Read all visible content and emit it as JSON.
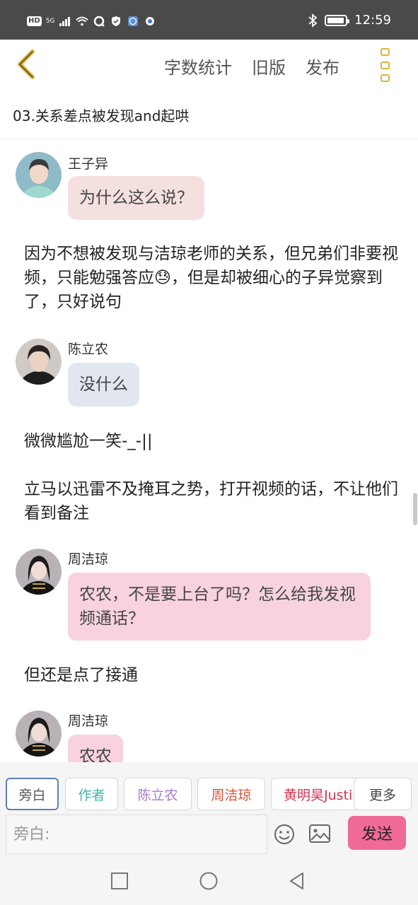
{
  "status_bar": {
    "left_badge": "HD",
    "signal": "5G",
    "time": "12:59"
  },
  "toolbar": {
    "back_icon": "chevron-left-icon",
    "word_count": "字数统计",
    "old_version": "旧版",
    "publish": "发布",
    "more_icon": "more-vertical-icon",
    "accent_color": "#d9b53a"
  },
  "chapter": {
    "title": "03.关系差点被发现and起哄"
  },
  "messages": [
    {
      "type": "chat",
      "name": "王子异",
      "text": "为什么这么说？",
      "bubble_color": "#f5e0e0"
    },
    {
      "type": "narration",
      "text": "因为不想被发现与洁琼老师的关系，但兄弟们非要视频，只能勉强答应😓，但是却被细心的子异觉察到了，只好说句"
    },
    {
      "type": "chat",
      "name": "陈立农",
      "text": "没什么",
      "bubble_color": "#e2e7ef"
    },
    {
      "type": "narration",
      "text": "微微尴尬一笑-_-||"
    },
    {
      "type": "narration",
      "text": "立马以迅雷不及掩耳之势，打开视频的话，不让他们看到备注"
    },
    {
      "type": "chat",
      "name": "周洁琼",
      "text": "农农，不是要上台了吗？怎么给我发视频通话？",
      "bubble_color": "#f8d3dd"
    },
    {
      "type": "narration",
      "text": "但还是点了接通"
    },
    {
      "type": "chat",
      "name": "周洁琼",
      "text": "农农",
      "bubble_color": "#f8d3dd"
    }
  ],
  "roles": [
    {
      "label": "旁白",
      "color": "#555555",
      "active": true
    },
    {
      "label": "作者",
      "color": "#3cb7a8",
      "active": false
    },
    {
      "label": "陈立农",
      "color": "#a57bd0",
      "active": false
    },
    {
      "label": "周洁琼",
      "color": "#d0563a",
      "active": false
    },
    {
      "label": "黄明昊Justin",
      "color": "#d2334e",
      "active": false
    },
    {
      "label": "更多",
      "color": "#444444",
      "active": false
    }
  ],
  "input": {
    "placeholder": "旁白:",
    "emoji_icon": "emoji-icon",
    "image_icon": "image-icon",
    "send_label": "发送",
    "send_color": "#f06a98"
  },
  "nav": {
    "recent_icon": "square-icon",
    "home_icon": "circle-icon",
    "back_icon": "triangle-back-icon"
  }
}
